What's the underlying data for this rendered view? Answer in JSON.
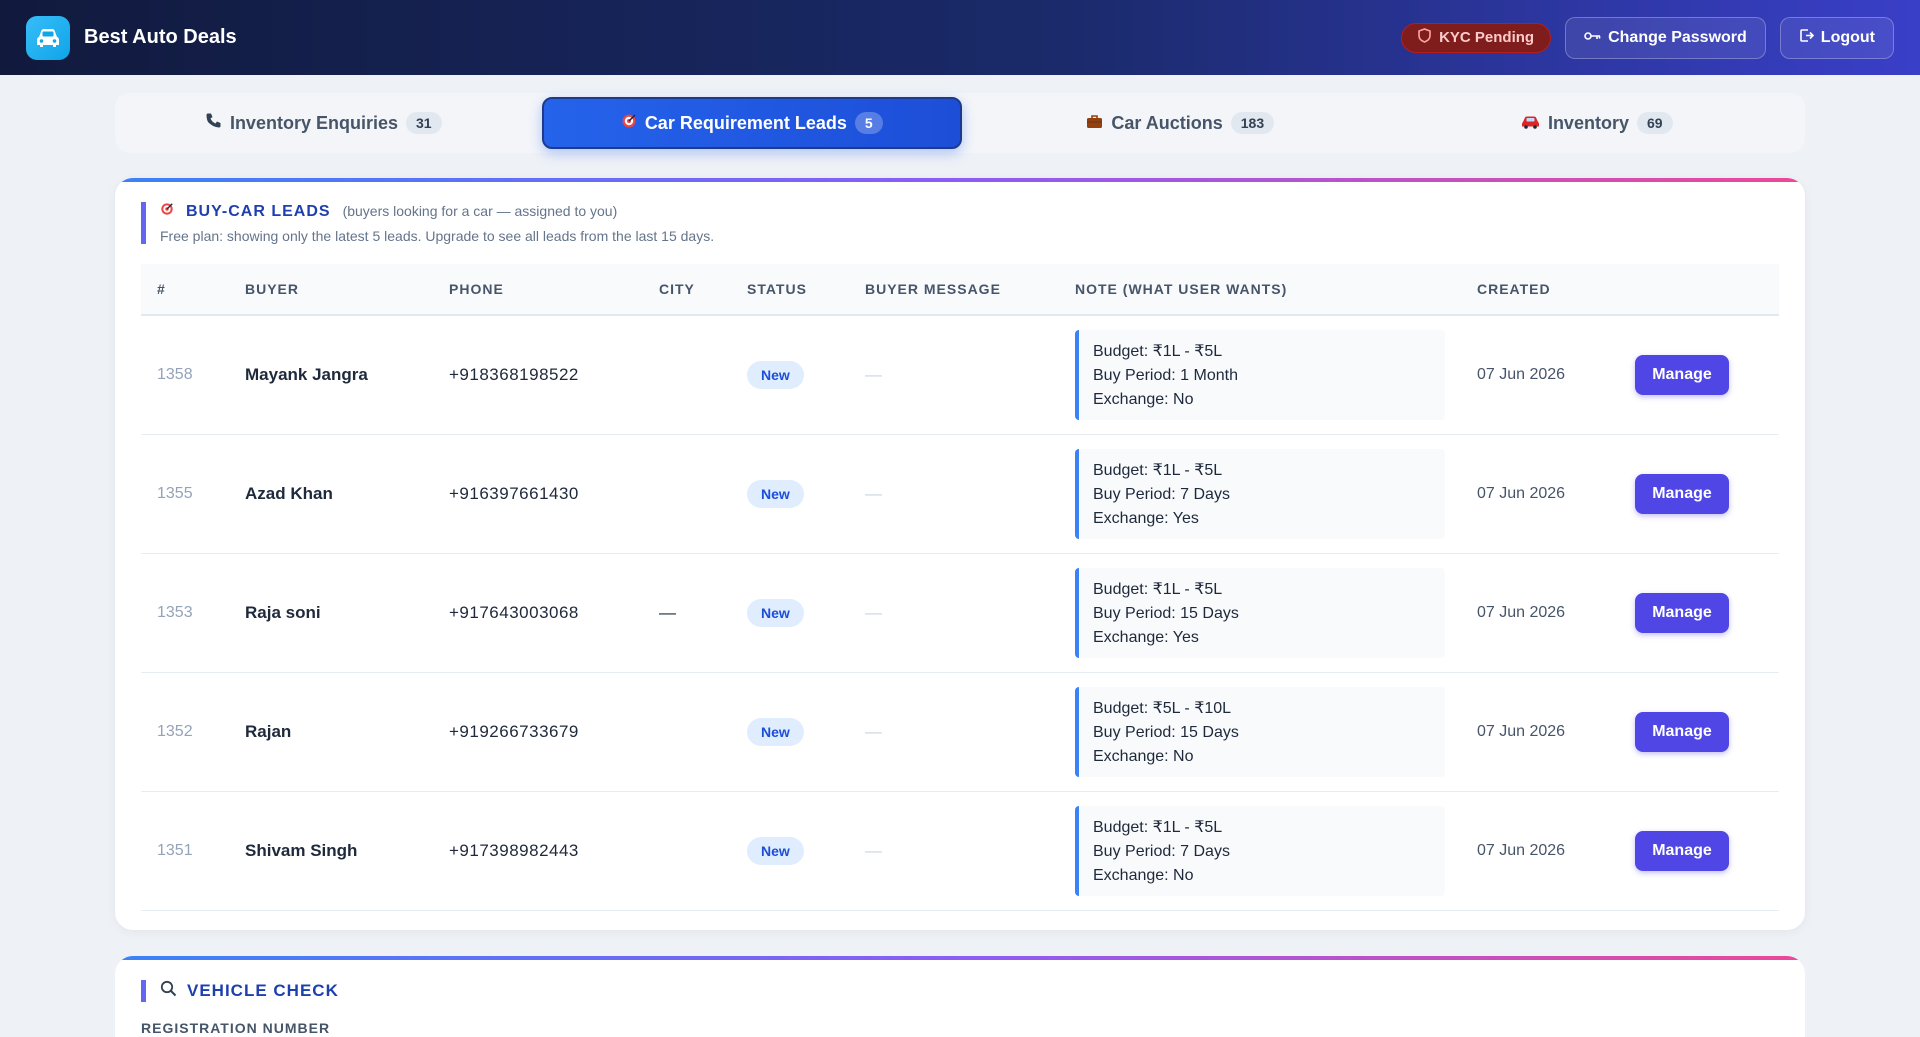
{
  "header": {
    "brand": "Best Auto Deals",
    "kyc_status": "KYC Pending",
    "change_password": "Change Password",
    "logout": "Logout"
  },
  "tabs": [
    {
      "label": "Inventory Enquiries",
      "count": "31",
      "icon": "phone-icon"
    },
    {
      "label": "Car Requirement Leads",
      "count": "5",
      "icon": "target-icon",
      "active": true
    },
    {
      "label": "Car Auctions",
      "count": "183",
      "icon": "briefcase-icon"
    },
    {
      "label": "Inventory",
      "count": "69",
      "icon": "car-icon"
    }
  ],
  "leads": {
    "title": "BUY-CAR LEADS",
    "subtitle": "(buyers looking for a car — assigned to you)",
    "plan_note": "Free plan: showing only the latest 5 leads. Upgrade to see all leads from the last 15 days.",
    "columns": [
      "#",
      "BUYER",
      "PHONE",
      "CITY",
      "STATUS",
      "BUYER MESSAGE",
      "NOTE (WHAT USER WANTS)",
      "CREATED",
      ""
    ],
    "action_label": "Manage",
    "rows": [
      {
        "id": "1358",
        "buyer": "Mayank Jangra",
        "phone": "+918368198522",
        "city": "",
        "status": "New",
        "message": "—",
        "budget": "Budget: ₹1L - ₹5L",
        "period": "Buy Period: 1 Month",
        "exchange": "Exchange: No",
        "created": "07 Jun 2026"
      },
      {
        "id": "1355",
        "buyer": "Azad Khan",
        "phone": "+916397661430",
        "city": "",
        "status": "New",
        "message": "—",
        "budget": "Budget: ₹1L - ₹5L",
        "period": "Buy Period: 7 Days",
        "exchange": "Exchange: Yes",
        "created": "07 Jun 2026"
      },
      {
        "id": "1353",
        "buyer": "Raja soni",
        "phone": "+917643003068",
        "city": "—",
        "status": "New",
        "message": "—",
        "budget": "Budget: ₹1L - ₹5L",
        "period": "Buy Period: 15 Days",
        "exchange": "Exchange: Yes",
        "created": "07 Jun 2026"
      },
      {
        "id": "1352",
        "buyer": "Rajan",
        "phone": "+919266733679",
        "city": "",
        "status": "New",
        "message": "—",
        "budget": "Budget: ₹5L - ₹10L",
        "period": "Buy Period: 15 Days",
        "exchange": "Exchange: No",
        "created": "07 Jun 2026"
      },
      {
        "id": "1351",
        "buyer": "Shivam Singh",
        "phone": "+917398982443",
        "city": "",
        "status": "New",
        "message": "—",
        "budget": "Budget: ₹1L - ₹5L",
        "period": "Buy Period: 7 Days",
        "exchange": "Exchange: No",
        "created": "07 Jun 2026"
      }
    ]
  },
  "vehicle_check": {
    "title": "VEHICLE CHECK",
    "reg_label": "REGISTRATION NUMBER"
  }
}
